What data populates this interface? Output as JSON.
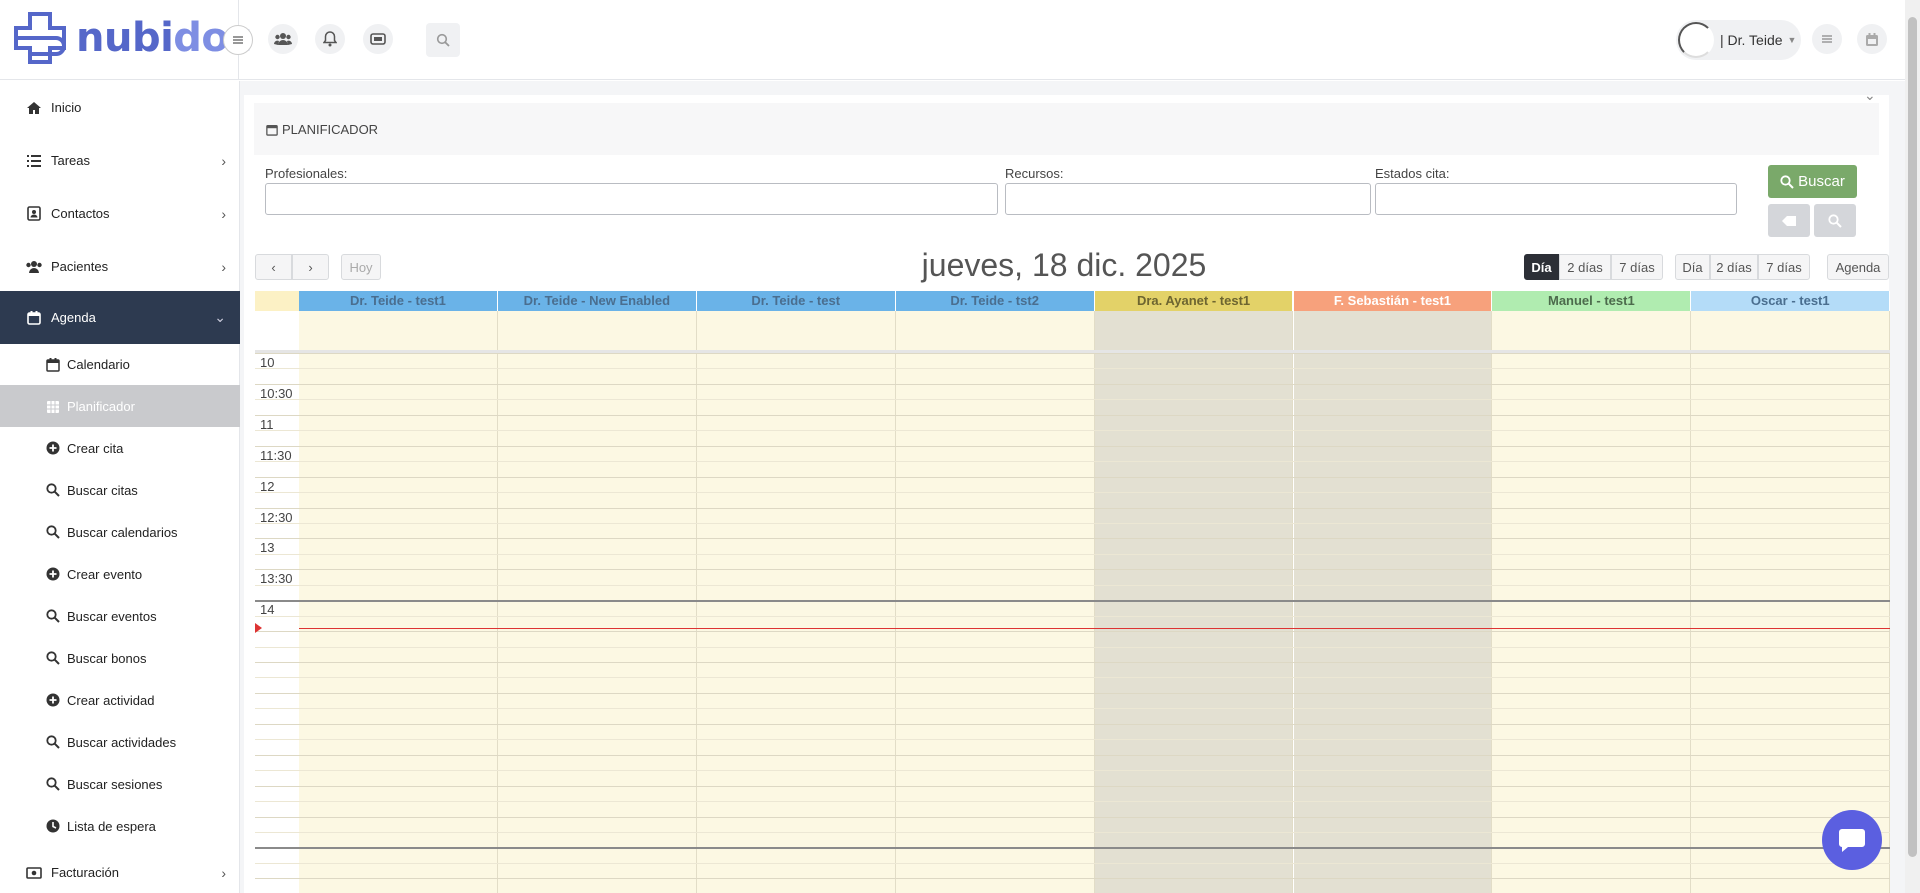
{
  "brand": {
    "part1": "nubi",
    "part2": "doc"
  },
  "user": {
    "name": "| Dr. Teide"
  },
  "sidebar": {
    "items": [
      {
        "label": "Inicio",
        "icon": "home-icon"
      },
      {
        "label": "Tareas",
        "icon": "list-icon"
      },
      {
        "label": "Contactos",
        "icon": "contacts-icon"
      },
      {
        "label": "Pacientes",
        "icon": "users-icon"
      },
      {
        "label": "Agenda",
        "icon": "calendar-icon"
      },
      {
        "label": "Facturación",
        "icon": "billing-icon"
      }
    ],
    "agenda_sub": [
      {
        "label": "Calendario",
        "icon": "calendar-icon"
      },
      {
        "label": "Planificador",
        "icon": "grid-calendar-icon"
      },
      {
        "label": "Crear cita",
        "icon": "plus-circle-icon"
      },
      {
        "label": "Buscar citas",
        "icon": "search-icon"
      },
      {
        "label": "Buscar calendarios",
        "icon": "search-icon"
      },
      {
        "label": "Crear evento",
        "icon": "plus-circle-icon"
      },
      {
        "label": "Buscar eventos",
        "icon": "search-icon"
      },
      {
        "label": "Buscar bonos",
        "icon": "search-icon"
      },
      {
        "label": "Crear actividad",
        "icon": "plus-circle-icon"
      },
      {
        "label": "Buscar actividades",
        "icon": "search-icon"
      },
      {
        "label": "Buscar sesiones",
        "icon": "search-icon"
      },
      {
        "label": "Lista de espera",
        "icon": "clock-icon"
      }
    ]
  },
  "panel": {
    "title": "PLANIFICADOR"
  },
  "filters": {
    "profesionales_label": "Profesionales:",
    "recursos_label": "Recursos:",
    "estados_label": "Estados cita:",
    "search_button": "Buscar"
  },
  "calendar": {
    "today_button": "Hoy",
    "title": "jueves, 18 dic. 2025",
    "views_a": [
      "Día",
      "2 días",
      "7 días"
    ],
    "views_b": [
      "Día",
      "2 días",
      "7 días"
    ],
    "agenda_button": "Agenda",
    "columns": [
      {
        "label": "Dr. Teide - test1",
        "color": "#6ab3e8",
        "text_color": "#4a6e8f",
        "body": "#fcf8e3"
      },
      {
        "label": "Dr. Teide - New Enabled",
        "color": "#6ab3e8",
        "text_color": "#4a6e8f",
        "body": "#fcf8e3"
      },
      {
        "label": "Dr. Teide - test",
        "color": "#6ab3e8",
        "text_color": "#4a6e8f",
        "body": "#fcf8e3"
      },
      {
        "label": "Dr. Teide - tst2",
        "color": "#6ab3e8",
        "text_color": "#4a6e8f",
        "body": "#fcf8e3"
      },
      {
        "label": "Dra. Ayanet - test1",
        "color": "#e3d268",
        "text_color": "#6d6530",
        "body": "#e3e0d2"
      },
      {
        "label": "F. Sebastián - test1",
        "color": "#f7a17c",
        "text_color": "#fff",
        "body": "#e3e0d2"
      },
      {
        "label": "Manuel - test1",
        "color": "#b0ecb0",
        "text_color": "#4c6b4c",
        "body": "#fcf8e3"
      },
      {
        "label": "Oscar - test1",
        "color": "#b4dcf8",
        "text_color": "#4a6e8f",
        "body": "#fcf8e3"
      }
    ],
    "times": [
      "10",
      "10:30",
      "11",
      "11:30",
      "12",
      "12:30",
      "13",
      "13:30",
      "14"
    ]
  }
}
